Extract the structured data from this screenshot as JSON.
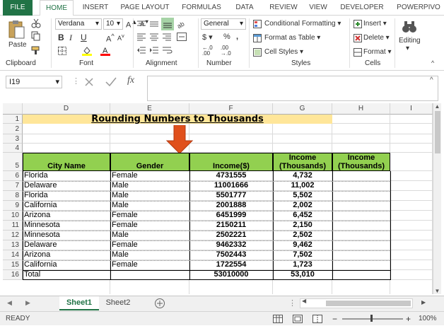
{
  "tabs": [
    "FILE",
    "HOME",
    "INSERT",
    "PAGE LAYOUT",
    "FORMULAS",
    "DATA",
    "REVIEW",
    "VIEW",
    "DEVELOPER",
    "POWERPIVO"
  ],
  "clipboard": {
    "paste": "Paste",
    "label": "Clipboard"
  },
  "font": {
    "name": "Verdana",
    "size": "10",
    "label": "Font"
  },
  "alignment": {
    "label": "Alignment"
  },
  "number": {
    "format": "General",
    "label": "Number"
  },
  "styles": {
    "conditional": "Conditional Formatting",
    "format_table": "Format as Table",
    "cell_styles": "Cell Styles",
    "label": "Styles"
  },
  "cells": {
    "insert": "Insert",
    "delete": "Delete",
    "format": "Format",
    "label": "Cells"
  },
  "editing": {
    "label": "Editing"
  },
  "formula_bar": {
    "name_box": "I19",
    "fx": "fx",
    "value": ""
  },
  "columns": [
    "D",
    "E",
    "F",
    "G",
    "H",
    "I"
  ],
  "rows": [
    "1",
    "2",
    "3",
    "4",
    "5",
    "6",
    "7",
    "8",
    "9",
    "10",
    "11",
    "12",
    "13",
    "14",
    "15",
    "16"
  ],
  "title": "Rounding Numbers to Thousands",
  "headers": {
    "city": "City Name",
    "gender": "Gender",
    "income": "Income($)",
    "inc_k_1": "Income",
    "inc_k_2": "(Thousands)",
    "inc_h_1": "Income",
    "inc_h_2": "(Thousands)"
  },
  "table": [
    {
      "city": "Florida",
      "gender": "Female",
      "income": "4731555",
      "k": "4,732"
    },
    {
      "city": "Delaware",
      "gender": "Male",
      "income": "11001666",
      "k": "11,002"
    },
    {
      "city": "Florida",
      "gender": "Male",
      "income": "5501777",
      "k": "5,502"
    },
    {
      "city": "California",
      "gender": "Male",
      "income": "2001888",
      "k": "2,002"
    },
    {
      "city": "Arizona",
      "gender": "Female",
      "income": "6451999",
      "k": "6,452"
    },
    {
      "city": "Minnesota",
      "gender": "Female",
      "income": "2150211",
      "k": "2,150"
    },
    {
      "city": "Minnesota",
      "gender": "Male",
      "income": "2502221",
      "k": "2,502"
    },
    {
      "city": "Delaware",
      "gender": "Female",
      "income": "9462332",
      "k": "9,462"
    },
    {
      "city": "Arizona",
      "gender": "Male",
      "income": "7502443",
      "k": "7,502"
    },
    {
      "city": "California",
      "gender": "Female",
      "income": "1722554",
      "k": "1,723"
    }
  ],
  "total": {
    "label": "Total",
    "income": "53010000",
    "k": "53,010"
  },
  "sheets": [
    "Sheet1",
    "Sheet2"
  ],
  "status": {
    "ready": "READY",
    "zoom": "100%"
  },
  "colors": {
    "excel_green": "#217346",
    "header_fill": "#92d050",
    "title_fill": "#ffe699",
    "arrow": "#e0501c"
  }
}
